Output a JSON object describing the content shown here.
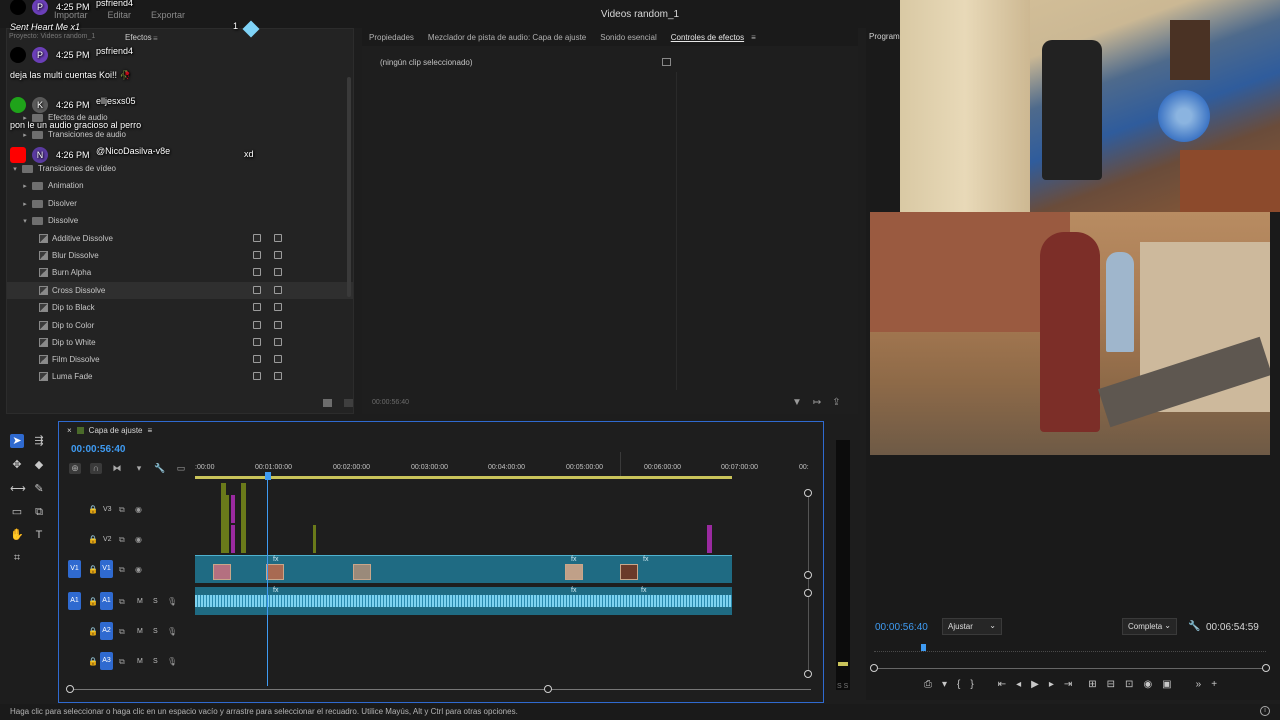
{
  "window": {
    "title": "Videos random_1"
  },
  "menu": [
    "Importar",
    "Editar",
    "Exportar"
  ],
  "project_panel": {
    "header_left": "Proyecto: Videos random_1",
    "header_tab": "Efectos",
    "items": [
      {
        "label": "Efectos de audio",
        "type": "folder",
        "expanded": false,
        "indent": 1
      },
      {
        "label": "Transiciones de audio",
        "type": "folder",
        "expanded": false,
        "indent": 1
      },
      {
        "label": "Transiciones de vídeo",
        "type": "folder",
        "expanded": true,
        "indent": 0
      },
      {
        "label": "Animation",
        "type": "folder",
        "expanded": false,
        "indent": 1
      },
      {
        "label": "Disolver",
        "type": "folder",
        "expanded": false,
        "indent": 1
      },
      {
        "label": "Dissolve",
        "type": "folder",
        "expanded": true,
        "indent": 1
      },
      {
        "label": "Additive Dissolve",
        "type": "effect",
        "indent": 2
      },
      {
        "label": "Blur Dissolve",
        "type": "effect",
        "indent": 2
      },
      {
        "label": "Burn Alpha",
        "type": "effect",
        "indent": 2
      },
      {
        "label": "Cross Dissolve",
        "type": "effect",
        "indent": 2,
        "selected": true
      },
      {
        "label": "Dip to Black",
        "type": "effect",
        "indent": 2
      },
      {
        "label": "Dip to Color",
        "type": "effect",
        "indent": 2
      },
      {
        "label": "Dip to White",
        "type": "effect",
        "indent": 2
      },
      {
        "label": "Film Dissolve",
        "type": "effect",
        "indent": 2
      },
      {
        "label": "Luma Fade",
        "type": "effect",
        "indent": 2
      }
    ]
  },
  "chat": [
    {
      "platform": "tiktok",
      "time": "4:25 PM",
      "user": "psfriend4",
      "initial": "P",
      "message": "Sent Heart Me x1",
      "badge": "1"
    },
    {
      "platform": "tiktok",
      "time": "4:25 PM",
      "user": "psfriend4",
      "initial": "P",
      "message": "deja las multi cuentas Koi!! 🥀"
    },
    {
      "platform": "kick",
      "time": "4:26 PM",
      "user": "elljesxs05",
      "initial": "K",
      "message": "pon le un audio gracioso al perro"
    },
    {
      "platform": "youtube",
      "time": "4:26 PM",
      "user": "@NicoDasilva-v8e",
      "initial": "N",
      "message": "xd"
    }
  ],
  "effects_panel": {
    "tabs": [
      "Propiedades",
      "Mezclador de pista de audio: Capa de ajuste",
      "Sonido esencial",
      "Controles de efectos"
    ],
    "active_tab": "Controles de efectos",
    "empty_text": "(ningún clip seleccionado)",
    "timecode": "00:00:56:40"
  },
  "program_monitor": {
    "label": "Programa",
    "timecode": "00:00:56:40",
    "fit": "Ajustar",
    "quality": "Completa",
    "duration": "00:06:54:59"
  },
  "timeline": {
    "sequence_name": "Capa de ajuste",
    "timecode": "00:00:56:40",
    "ruler_labels": [
      ":00:00",
      "00:01:00:00",
      "00:02:00:00",
      "00:03:00:00",
      "00:04:00:00",
      "00:05:00:00",
      "00:06:00:00",
      "00:07:00:00",
      "00:"
    ],
    "tracks": [
      {
        "name": "V3",
        "kind": "video"
      },
      {
        "name": "V2",
        "kind": "video"
      },
      {
        "name": "V1",
        "kind": "video",
        "source": "V1"
      },
      {
        "name": "A1",
        "kind": "audio",
        "source": "A1"
      },
      {
        "name": "A2",
        "kind": "audio"
      },
      {
        "name": "A3",
        "kind": "audio"
      }
    ],
    "mute_label": "M",
    "solo_label": "S",
    "fx_label": "fx"
  },
  "meter_label": "S S",
  "status_bar": {
    "text": "Haga clic para seleccionar o haga clic en un espacio vacío y arrastre para seleccionar el recuadro. Utilice Mayús, Alt y Ctrl para otras opciones."
  },
  "colors": {
    "accent": "#2f6ad0",
    "timecode": "#3f9bf2",
    "clip": "#1f6b83",
    "tiktok": "#000000",
    "kick": "#53fc18",
    "youtube": "#ff0000"
  }
}
